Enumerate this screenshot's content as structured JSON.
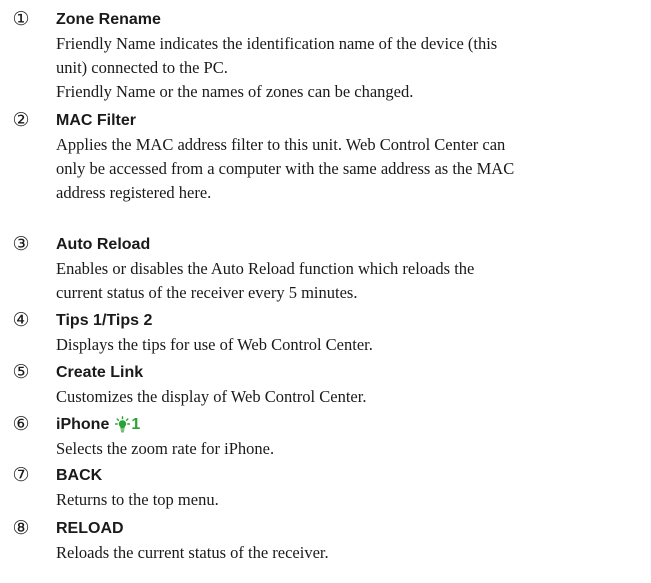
{
  "items": [
    {
      "number": "①",
      "title": "Zone Rename",
      "description": [
        "Friendly Name indicates the identification name of the device (this",
        "unit) connected to the PC.",
        "Friendly Name or the names of zones can be changed."
      ]
    },
    {
      "number": "②",
      "title": "MAC Filter",
      "description": [
        "Applies the MAC address filter to this unit. Web Control Center can",
        "only be accessed from a computer with the same address as the MAC",
        "address registered here."
      ]
    },
    {
      "number": "③",
      "title": "Auto Reload",
      "description": [
        "Enables or disables the Auto Reload function which reloads the",
        "current status of the receiver every 5 minutes."
      ]
    },
    {
      "number": "④",
      "title": "Tips 1/Tips 2",
      "description": [
        "Displays the tips for use of Web Control Center."
      ]
    },
    {
      "number": "⑤",
      "title": "Create Link",
      "description": [
        "Customizes the display of Web Control Center."
      ]
    },
    {
      "number": "⑥",
      "title": "iPhone",
      "note_ref": "1",
      "note_icon": "tip-bulb-icon",
      "note_color": "#2aa336",
      "description": [
        "Selects the zoom rate for iPhone."
      ]
    },
    {
      "number": "⑦",
      "title": "BACK",
      "description": [
        "Returns to the top menu."
      ]
    },
    {
      "number": "⑧",
      "title": "RELOAD",
      "description": [
        "Reloads the current status of the receiver."
      ]
    }
  ]
}
